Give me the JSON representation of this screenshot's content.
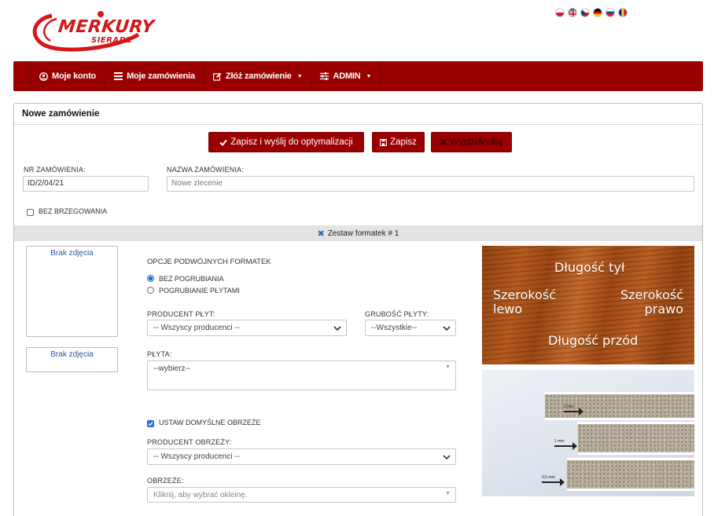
{
  "logo": {
    "text": "MERKURY",
    "sub": "SIERADZ"
  },
  "flags": [
    "pl",
    "gb",
    "cz",
    "de",
    "sk",
    "ro"
  ],
  "nav": {
    "items": [
      {
        "label": "Moje konto",
        "icon": "user-circle-icon"
      },
      {
        "label": "Moje zamówienia",
        "icon": "list-icon"
      },
      {
        "label": "Złóż zamówienie",
        "icon": "edit-icon",
        "caret": true
      },
      {
        "label": "ADMIN",
        "icon": "sliders-icon",
        "caret": true
      }
    ]
  },
  "panel": {
    "title": "Nowe zamówienie",
    "buttons": {
      "save_send": "Zapisz i wyślij do optymalizacji",
      "save": "Zapisz",
      "exit": "Wyjdź/Anuluj"
    },
    "order_no_label": "NR ZAMÓWIENIA:",
    "order_no_value": "ID/2/04/21",
    "order_name_label": "NAZWA ZAMÓWIENIA:",
    "order_name_placeholder": "Nowe zlecenie",
    "no_edging_label": "BEZ BRZEGOWANIA",
    "set_title": "Zestaw formatek # 1",
    "no_photo": "Brak zdjęcia",
    "double_options_label": "OPCJE PODWÓJNYCH FORMATEK",
    "radio_options": [
      "BEZ POGRUBIANIA",
      "POGRUBIANIE PŁYTAMI"
    ],
    "board_producer_label": "PRODUCENT PŁYT:",
    "board_producer_value": "-- Wszyscy producenci --",
    "thickness_label": "GRUBOŚĆ PŁYTY:",
    "thickness_value": "--Wszystkie--",
    "board_label": "PŁYTA:",
    "board_value": "--wybierz--",
    "default_edge_label": "USTAW DOMYŚLNE OBRZEŻE",
    "edge_producer_label": "PRODUCENT OBRZEŻY:",
    "edge_producer_value": "-- Wszyscy producenci --",
    "edge_label": "OBRZEŻE:",
    "edge_placeholder": "Kliknij, aby wybrać okleinę."
  },
  "diagram": {
    "back_length": "Długość tył",
    "left_width_1": "Szerokość",
    "left_width_2": "lewo",
    "right_width_1": "Szerokość",
    "right_width_2": "prawo",
    "front_length": "Długość przód"
  },
  "board_photo": {
    "labels": [
      "2 mm",
      "1 mm",
      "0,5 mm"
    ]
  },
  "colors": {
    "brand": "#9b0000",
    "accent": "#1e6fd9"
  }
}
